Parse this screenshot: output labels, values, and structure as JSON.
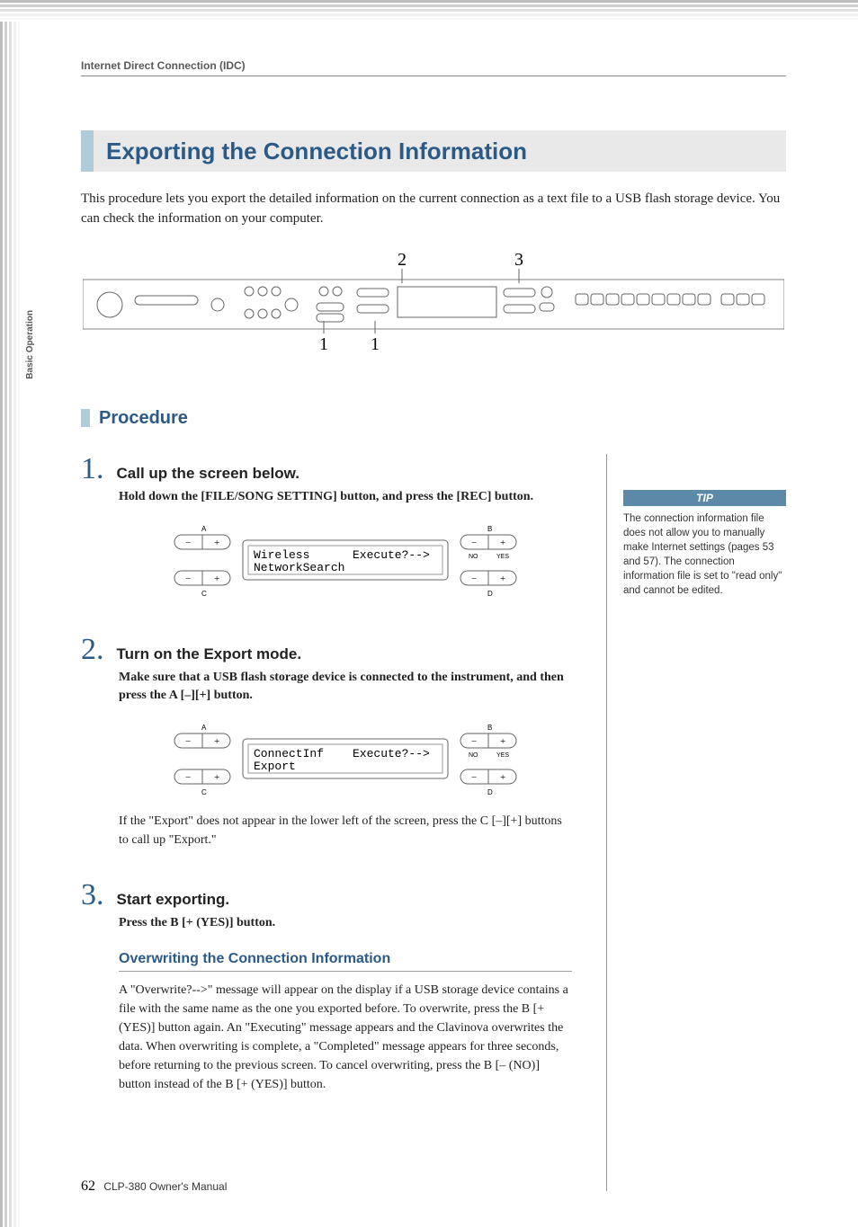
{
  "breadcrumb": "Internet Direct Connection (IDC)",
  "side_tab": "Basic Operation",
  "heading": "Exporting the Connection Information",
  "intro": "This procedure lets you export the detailed information on the current connection as a text file to a USB flash storage device. You can check the information on your computer.",
  "panel_callouts": {
    "a": "1",
    "b": "1",
    "c": "2",
    "d": "3"
  },
  "procedure_label": "Procedure",
  "steps": [
    {
      "num": "1.",
      "title": "Call up the screen below.",
      "bold": "Hold down the [FILE/SONG SETTING] button, and press the [REC] button.",
      "lcd": {
        "line1": "Wireless",
        "line2": "NetworkSearch",
        "right": "Execute?-->"
      }
    },
    {
      "num": "2.",
      "title": "Turn on the Export mode.",
      "bold": "Make sure that a USB flash storage device is connected to the instrument, and then press the A [–][+] button.",
      "lcd": {
        "line1": "ConnectInf",
        "line2": "Export",
        "right": "Execute?-->"
      },
      "text_after": "If the \"Export\" does not appear in the lower left of the screen, press the C [–][+] buttons to call up \"Export.\""
    },
    {
      "num": "3.",
      "title": "Start exporting.",
      "bold": "Press the B [+ (YES)] button.",
      "subhead": "Overwriting the Connection Information",
      "subtext": "A \"Overwrite?-->\" message will appear on the display if a USB storage device contains a file with the same name as the one you exported before. To overwrite, press the B [+ (YES)] button again. An \"Executing\" message appears and the Clavinova overwrites the data. When overwriting is complete, a \"Completed\" message appears for three seconds, before returning to the previous screen. To cancel overwriting, press the B [– (NO)] button instead of the B [+ (YES)] button."
    }
  ],
  "tip": {
    "label": "TIP",
    "text": "The connection information file does not allow you to manually make Internet settings (pages 53 and 57). The connection information file is set to \"read only\" and cannot be edited."
  },
  "lcd_labels": {
    "A": "A",
    "B": "B",
    "C": "C",
    "D": "D",
    "NO": "NO",
    "YES": "YES"
  },
  "footer": {
    "page": "62",
    "manual": "CLP-380 Owner's Manual"
  }
}
